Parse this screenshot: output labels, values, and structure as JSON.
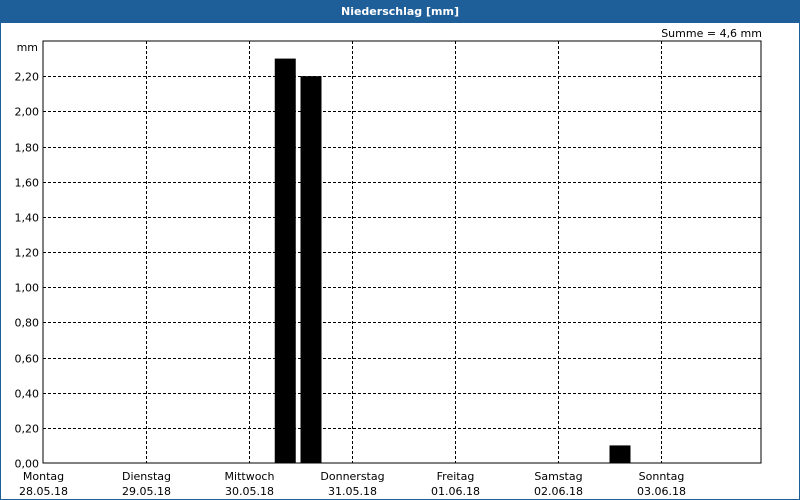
{
  "chart_data": {
    "type": "bar",
    "title": "Niederschlag [mm]",
    "ylabel": "mm",
    "annotation": "Summe = 4,6 mm",
    "ylim": [
      0,
      2.4
    ],
    "yticks": [
      "0,00",
      "0,20",
      "0,40",
      "0,60",
      "0,80",
      "1,00",
      "1,20",
      "1,40",
      "1,60",
      "1,80",
      "2,00",
      "2,20"
    ],
    "days": [
      {
        "weekday": "Montag",
        "date": "28.05.18"
      },
      {
        "weekday": "Dienstag",
        "date": "29.05.18"
      },
      {
        "weekday": "Mittwoch",
        "date": "30.05.18"
      },
      {
        "weekday": "Donnerstag",
        "date": "31.05.18"
      },
      {
        "weekday": "Freitag",
        "date": "01.06.18"
      },
      {
        "weekday": "Samstag",
        "date": "02.06.18"
      },
      {
        "weekday": "Sonntag",
        "date": "03.06.18"
      }
    ],
    "bars": [
      {
        "time": "30.05.18 06:00",
        "value": 2.3
      },
      {
        "time": "30.05.18 12:00",
        "value": 2.2
      },
      {
        "time": "02.06.18 12:00",
        "value": 0.1
      }
    ],
    "grid": true
  }
}
